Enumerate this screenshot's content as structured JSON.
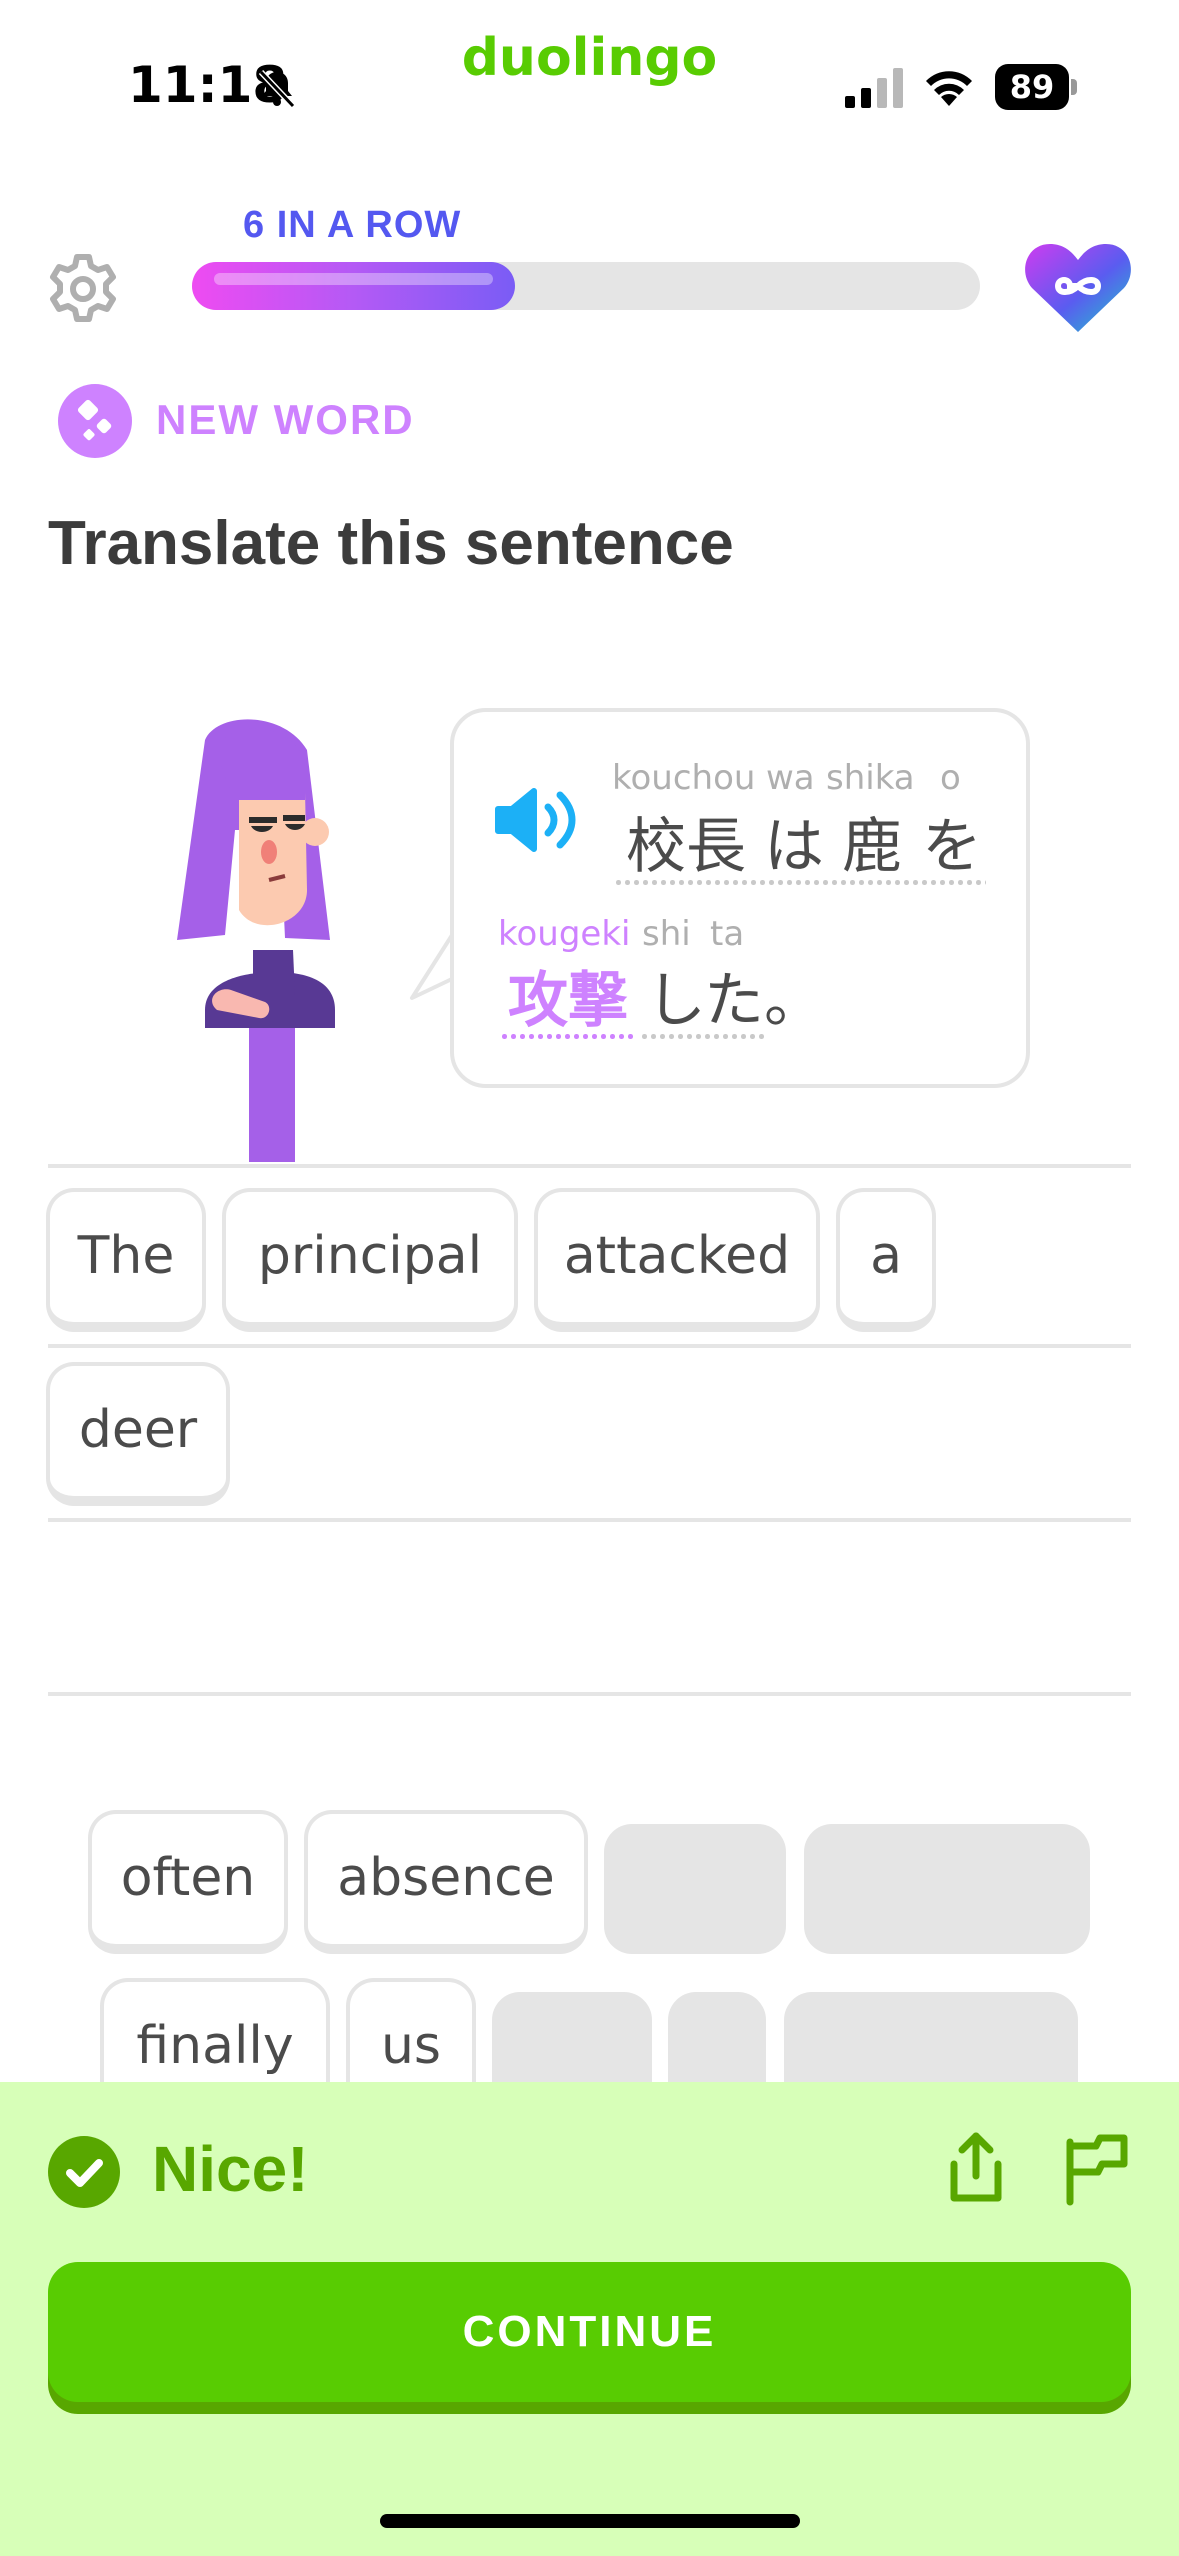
{
  "status_bar": {
    "time": "11:18",
    "battery": "89"
  },
  "app": {
    "logo": "duolingo"
  },
  "header": {
    "streak_label": "6 IN A ROW",
    "progress_fraction": 0.41
  },
  "badge": {
    "label": "NEW WORD",
    "color": "#ce82ff"
  },
  "prompt": {
    "title": "Translate this sentence"
  },
  "bubble": {
    "line1": [
      {
        "reading": "kouchou",
        "text": "校長"
      },
      {
        "reading": "wa",
        "text": "は"
      },
      {
        "reading": "shika",
        "text": "鹿"
      },
      {
        "reading": "o",
        "text": "を"
      }
    ],
    "line2": [
      {
        "reading": "kougeki",
        "text": "攻撃",
        "highlight": true
      },
      {
        "reading": "shi",
        "text": "し"
      },
      {
        "reading": "ta",
        "text": "た。"
      }
    ]
  },
  "answer_words": [
    "The",
    "principal",
    "attacked",
    "a",
    "deer"
  ],
  "word_bank": [
    "often",
    "absence",
    "finally",
    "us"
  ],
  "feedback": {
    "message": "Nice!",
    "continue_label": "CONTINUE"
  },
  "colors": {
    "primary_green": "#58cc02",
    "dark_green": "#58a700",
    "sheet_bg": "#d7ffb8",
    "streak_blue": "#5458f0",
    "new_word_purple": "#ce82ff"
  }
}
